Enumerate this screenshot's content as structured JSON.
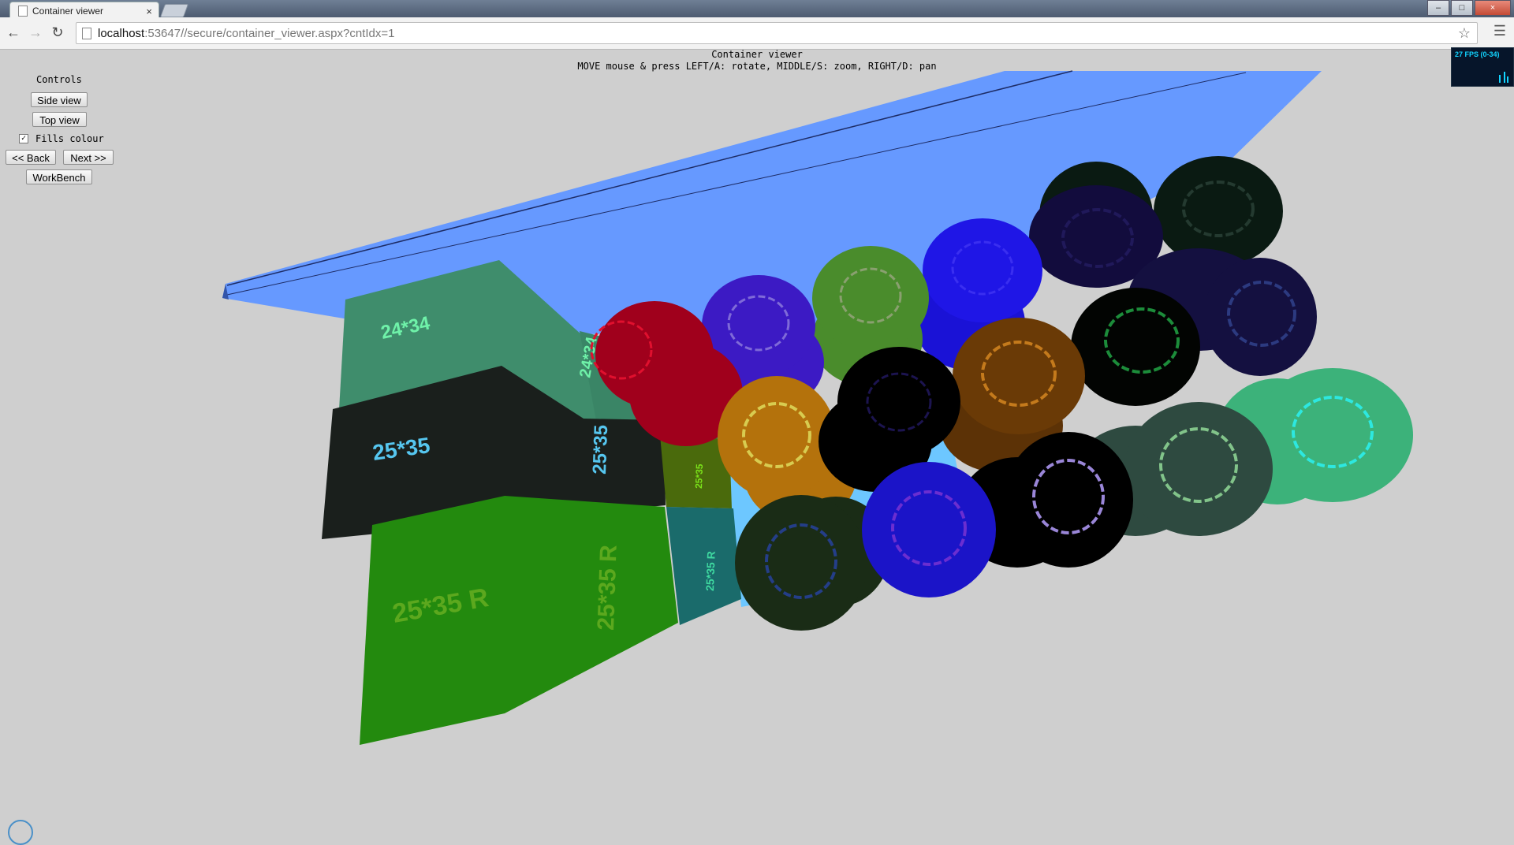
{
  "browser": {
    "tab_title": "Container viewer",
    "tab_close": "×",
    "url_host": "localhost",
    "url_rest": ":53647//secure/container_viewer.aspx?cntIdx=1",
    "back_icon": "arrow-left-icon",
    "forward_icon": "arrow-right-icon",
    "reload_icon": "reload-icon",
    "minimize": "–",
    "maximize": "□",
    "close": "×"
  },
  "viewer": {
    "title": "Container viewer",
    "instructions": "MOVE mouse & press LEFT/A: rotate, MIDDLE/S: zoom, RIGHT/D: pan"
  },
  "controls": {
    "heading": "Controls",
    "side_view": "Side view",
    "top_view": "Top view",
    "fills_colour": "Fills colour",
    "fills_checked": true,
    "back": "<< Back",
    "next": "Next >>",
    "workbench": "WorkBench"
  },
  "fps": {
    "text": "27 FPS (0-34)"
  },
  "scene": {
    "box_labels": {
      "a": "24*34",
      "a_side": "24*34",
      "b": "25*35",
      "b_side": "25*35",
      "c": "25*35 R",
      "c_side": "25*35 R",
      "small_1": "25*35",
      "small_2": "25*35 R"
    },
    "colors": {
      "platform": "#6699ff",
      "box_a": "#3f8d6c",
      "box_b": "#1a1f1c",
      "box_c": "#238a0e"
    }
  }
}
